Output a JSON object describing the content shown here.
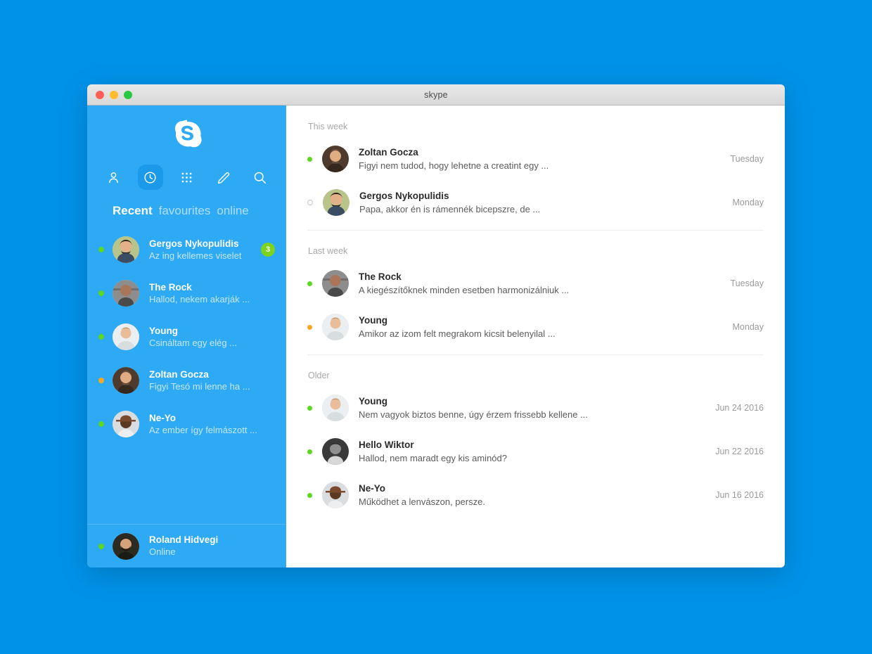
{
  "window": {
    "title": "skype",
    "controls": {
      "close": "close",
      "minimize": "minimize",
      "maximize": "maximize"
    }
  },
  "sidebar": {
    "logo_label": "Skype",
    "nav": [
      {
        "name": "contacts-icon",
        "label": "Contacts",
        "active": false
      },
      {
        "name": "recent-icon",
        "label": "Recent",
        "active": true
      },
      {
        "name": "dialpad-icon",
        "label": "Dial pad",
        "active": false
      },
      {
        "name": "compose-icon",
        "label": "New message",
        "active": false
      },
      {
        "name": "search-icon",
        "label": "Search",
        "active": false
      }
    ],
    "tabs": [
      {
        "label": "Recent",
        "active": true
      },
      {
        "label": "favourites",
        "active": false
      },
      {
        "label": "online",
        "active": false
      }
    ],
    "contacts": [
      {
        "name": "Gergos Nykopulidis",
        "message": "Az ing kellemes viselet",
        "status": "online",
        "badge": "3"
      },
      {
        "name": "The Rock",
        "message": "Hallod, nekem akarják ...",
        "status": "online",
        "badge": ""
      },
      {
        "name": "Young",
        "message": "Csináltam egy elég ...",
        "status": "online",
        "badge": ""
      },
      {
        "name": "Zoltan Gocza",
        "message": "Figyi Tesó mi lenne ha ...",
        "status": "away",
        "badge": ""
      },
      {
        "name": "Ne-Yo",
        "message": "Az ember így felmászott ...",
        "status": "online",
        "badge": ""
      }
    ],
    "me": {
      "name": "Roland Hidvegi",
      "status_text": "Online",
      "status": "online"
    }
  },
  "main": {
    "groups": [
      {
        "label": "This week",
        "items": [
          {
            "name": "Zoltan Gocza",
            "message": "Figyi nem tudod, hogy lehetne a creatint egy ...",
            "time": "Tuesday",
            "status": "online"
          },
          {
            "name": "Gergos Nykopulidis",
            "message": "Papa, akkor én is rámennék bicepszre, de ...",
            "time": "Monday",
            "status": "offline"
          }
        ]
      },
      {
        "label": "Last week",
        "items": [
          {
            "name": "The Rock",
            "message": "A kiegészítőknek minden esetben harmonizálniuk ...",
            "time": "Tuesday",
            "status": "online"
          },
          {
            "name": "Young",
            "message": "Amikor az izom felt megrakom kicsit belenyilal ...",
            "time": "Monday",
            "status": "away"
          }
        ]
      },
      {
        "label": "Older",
        "items": [
          {
            "name": "Young",
            "message": "Nem vagyok biztos benne, úgy érzem frissebb kellene ...",
            "time": "Jun 24 2016",
            "status": "online"
          },
          {
            "name": "Hello Wiktor",
            "message": "Hallod, nem maradt egy kis aminód?",
            "time": "Jun 22 2016",
            "status": "online"
          },
          {
            "name": "Ne-Yo",
            "message": "Működhet a lenvászon, persze.",
            "time": "Jun 16 2016",
            "status": "online"
          }
        ]
      }
    ]
  },
  "colors": {
    "desktop": "#0092e8",
    "sidebar": "#2eaaf5",
    "nav_active": "#1a9ae8",
    "online": "#5cd820",
    "away": "#f7a823",
    "badge": "#7ed321"
  }
}
